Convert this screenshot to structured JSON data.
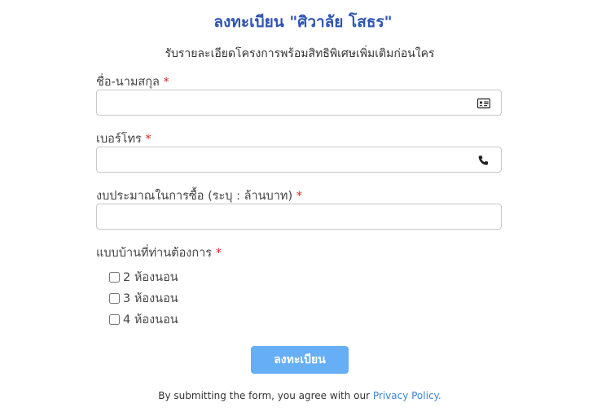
{
  "form": {
    "title": "ลงทะเบียน \"ศิวาลัย โสธร\"",
    "subtitle": "รับรายละเอียดโครงการพร้อมสิทธิพิเศษเพิ่มเติมก่อนใคร",
    "required_mark": "*",
    "fields": {
      "name": {
        "label": "ชื่อ-นามสกุล",
        "value": "",
        "icon": "id-card-icon"
      },
      "phone": {
        "label": "เบอร์โทร",
        "value": "",
        "icon": "phone-icon"
      },
      "budget": {
        "label": "งบประมาณในการซื้อ (ระบุ : ล้านบาท)",
        "value": ""
      }
    },
    "house_type": {
      "label": "แบบบ้านที่ท่านต้องการ",
      "options": [
        {
          "label": "2 ห้องนอน",
          "checked": false
        },
        {
          "label": "3 ห้องนอน",
          "checked": false
        },
        {
          "label": "4 ห้องนอน",
          "checked": false
        }
      ]
    },
    "submit_label": "ลงทะเบียน",
    "footer_text": "By submitting the form, you agree with our",
    "privacy_link": "Privacy Policy."
  },
  "colors": {
    "title": "#2f55b3",
    "button": "#66aef5",
    "link": "#3b82d6",
    "required": "#e02020"
  }
}
